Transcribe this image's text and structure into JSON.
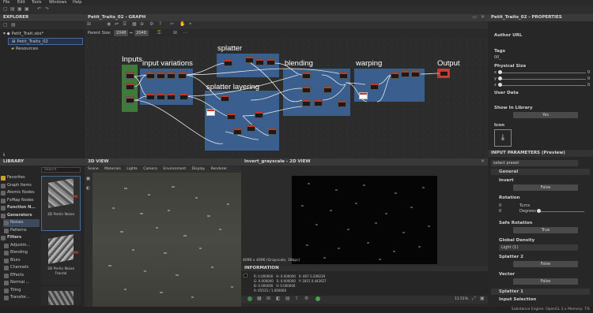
{
  "menu": [
    "File",
    "Edit",
    "Tools",
    "Windows",
    "Help"
  ],
  "explorer": {
    "title": "EXPLORER",
    "package": "Petit_Trait.sbs*",
    "graph": "Petit_Traits_02",
    "resources": "Resources"
  },
  "graph": {
    "tab": "Petit_Traits_02 - GRAPH",
    "parent_size_label": "Parent Size:",
    "parent_size": "2048",
    "size": "2048",
    "frames": {
      "inputs": "Inputs",
      "input_variations": "input variations",
      "splatter": "splatter",
      "splatter_layering": "splatter layering",
      "blending": "blending",
      "warping": "warping",
      "output": "Output"
    }
  },
  "properties": {
    "tab": "Petit_Traits_02 - PROPERTIES",
    "author_url": "Author URL",
    "tags": "Tags",
    "tags_value": "00_",
    "physical_size": "Physical Size",
    "axes": [
      "x",
      "y",
      "z"
    ],
    "values": [
      "0",
      "0",
      "0"
    ],
    "user_data": "User Data",
    "show_in_library": "Show In Library",
    "show_in_library_value": "Yes",
    "icon": "Icon"
  },
  "library": {
    "title": "LIBRARY",
    "search_placeholder": "Search",
    "items": [
      "Favorites",
      "Graph Items",
      "Atomic Nodes",
      "FxMap Nodes",
      "Function N...",
      "Generators",
      "Noises",
      "Patterns",
      "Filters",
      "Adjustm...",
      "Blending",
      "Blurs",
      "Channels",
      "Effects",
      "Normal ...",
      "Tiling",
      "Transfor..."
    ],
    "thumbs": [
      "3D Perlin Noise",
      "3D Perlin Noise Fractal",
      ""
    ]
  },
  "view3d": {
    "title": "3D VIEW",
    "menu": [
      "Scene",
      "Materials",
      "Lights",
      "Camera",
      "Environment",
      "Display",
      "Renderer"
    ]
  },
  "view2d": {
    "title": "Invert_grayscale - 2D VIEW",
    "size_info": "4096 x 4096 (Grayscale, 16bpc)",
    "zoom": "11.51%"
  },
  "information": {
    "title": "INFORMATION",
    "rows": [
      [
        "R:",
        "0.000000",
        "H:",
        "0.000000",
        "X:",
        "807",
        "0.209229"
      ],
      [
        "G:",
        "0.000000",
        "S:",
        "0.000000",
        "Y:",
        "1815",
        "0.443627"
      ],
      [
        "B:",
        "0.000000",
        "V:",
        "0.000000",
        "",
        "",
        " "
      ],
      [
        "A:",
        "65535",
        "1.000000",
        "",
        "",
        "",
        ""
      ]
    ]
  },
  "input_params": {
    "title": "INPUT PARAMETERS (Preview)",
    "preset": "select preset",
    "general": "General",
    "invert": "Invert",
    "invert_value": "False",
    "rotation": "Rotation",
    "turns": "Turns",
    "degrees": "Degrees",
    "rot_val1": "0",
    "rot_val2": "0",
    "safe_rotation": "Safe Rotation",
    "safe_rotation_value": "True",
    "global_density": "Global Density",
    "global_density_value": "Light (1)",
    "splatter2": "Splatter 2",
    "splatter2_value": "False",
    "vector": "Vector",
    "vector_value": "False",
    "splatter1": "Splatter 1",
    "input_selection": "Input Selection"
  },
  "status": "Substance Engine: OpenGL 3.x  Memory: 7%"
}
